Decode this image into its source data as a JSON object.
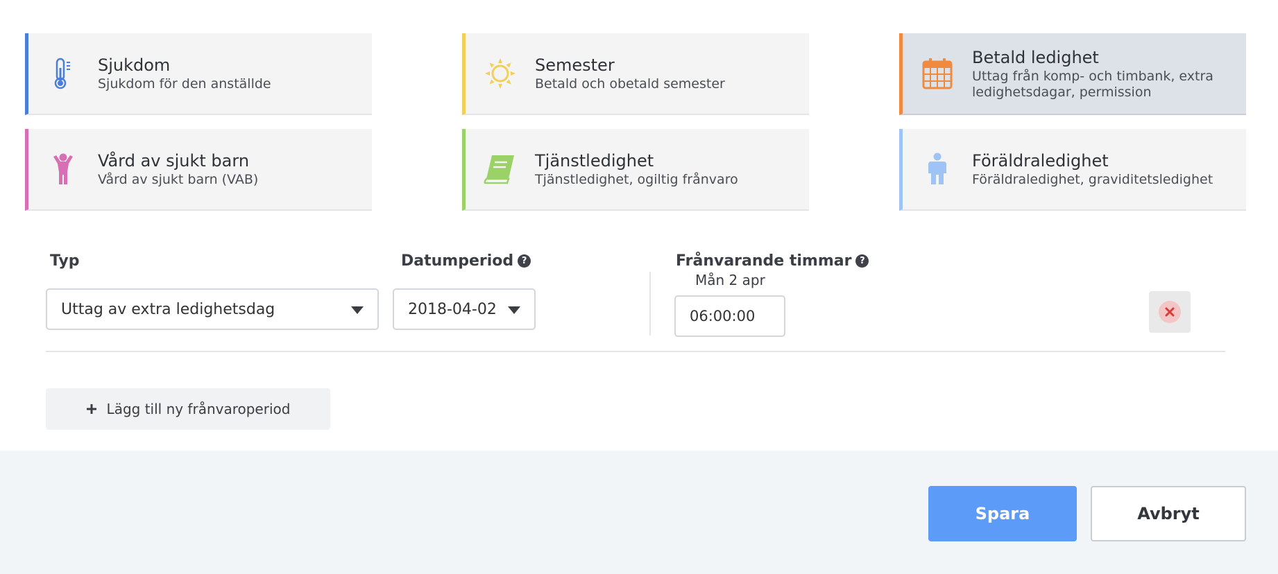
{
  "categories": [
    {
      "title": "Sjukdom",
      "description": "Sjukdom för den anställde",
      "icon": "thermometer-icon",
      "color": "#4a7fd9",
      "selected": false
    },
    {
      "title": "Semester",
      "description": "Betald och obetald semester",
      "icon": "sun-icon",
      "color": "#f2cf5b",
      "selected": false
    },
    {
      "title": "Betald ledighet",
      "description": "Uttag från komp- och timbank, extra ledighetsdagar, permission",
      "icon": "calendar-icon",
      "color": "#ef8a3e",
      "selected": true
    },
    {
      "title": "Vård av sjukt barn",
      "description": "Vård av sjukt barn (VAB)",
      "icon": "child-icon",
      "color": "#d86fb4",
      "selected": false
    },
    {
      "title": "Tjänstledighet",
      "description": "Tjänstledighet, ogiltig frånvaro",
      "icon": "book-icon",
      "color": "#9bd267",
      "selected": false
    },
    {
      "title": "Föräldraledighet",
      "description": "Föräldraledighet, graviditetsledighet",
      "icon": "person-icon",
      "color": "#9fc3f4",
      "selected": false
    }
  ],
  "form": {
    "type_label": "Typ",
    "type_value": "Uttag av extra ledighetsdag",
    "date_label": "Datumperiod",
    "date_value": "2018-04-02",
    "hours_label": "Frånvarande timmar",
    "day_label": "Mån 2 apr",
    "hours_value": "06:00:00",
    "help_glyph": "?"
  },
  "add_period_label": "Lägg till ny frånvaroperiod",
  "footer": {
    "save_label": "Spara",
    "cancel_label": "Avbryt"
  }
}
